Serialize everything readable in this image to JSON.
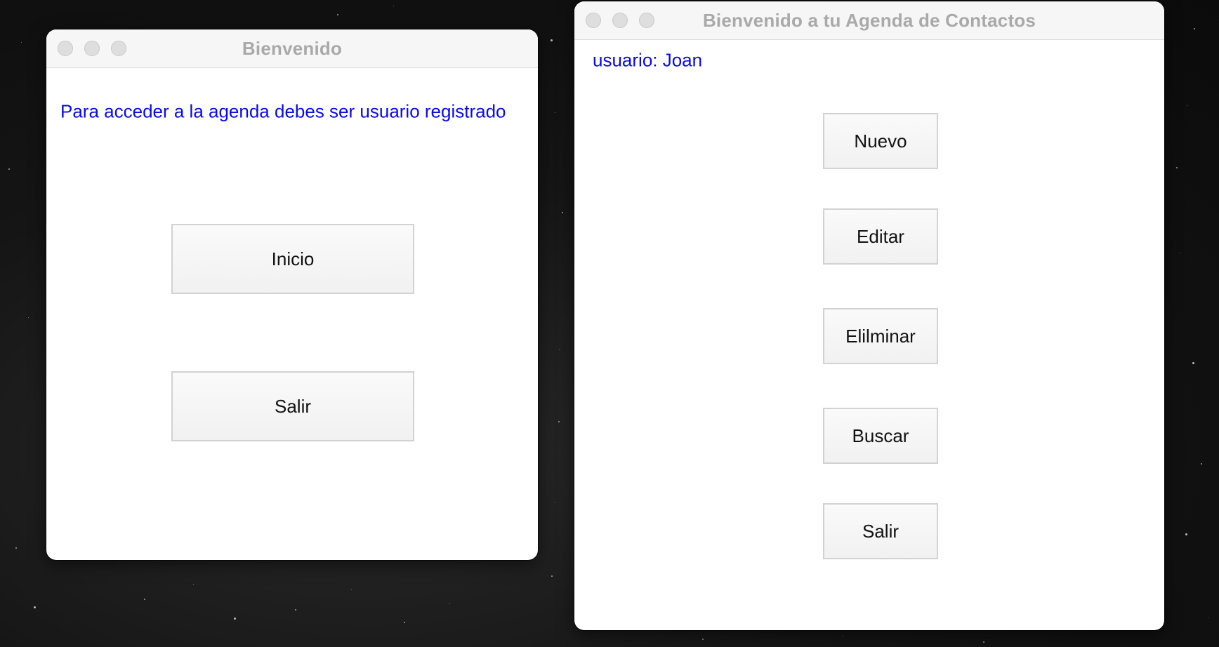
{
  "welcome_window": {
    "title": "Bienvenido",
    "message": "Para acceder a la agenda debes ser usuario registrado",
    "buttons": {
      "inicio": "Inicio",
      "salir": "Salir"
    }
  },
  "agenda_window": {
    "title": "Bienvenido a tu Agenda de Contactos",
    "user_label": "usuario: Joan",
    "buttons": {
      "nuevo": "Nuevo",
      "editar": "Editar",
      "eliminar": "Elilminar",
      "buscar": "Buscar",
      "salir": "Salir"
    }
  },
  "colors": {
    "label_text": "#0a0ae6",
    "title_text": "#a9a9a9",
    "window_bg": "#ffffff",
    "desktop_bg": "#151515"
  }
}
